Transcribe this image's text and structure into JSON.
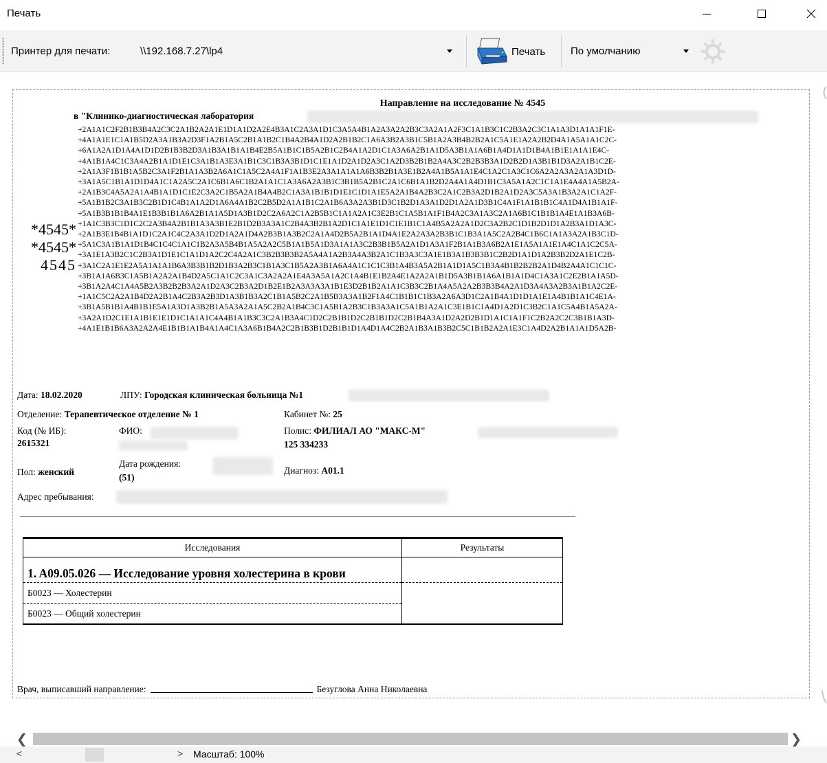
{
  "window": {
    "title": "Печать"
  },
  "toolbar": {
    "printer_label": "Принтер для печати:",
    "printer_value": "\\\\192.168.7.27\\lp4",
    "print_button": "Печать",
    "mode_value": "По умолчанию"
  },
  "document": {
    "title": "Направление на исследование № 4545",
    "laboratory": "в \"Клинико-диагностическая лаборатория",
    "barcode_lines": [
      "*4545*",
      "*4545*",
      "4545"
    ],
    "code_lines": [
      "+2A1A1C2F2B1B3B4A2C3C2A1B2A2A1E1D1A1D2A2E4B3A1C2A3A1D1C3A5A4B1A2A3A2A2B3C3A2A1A2F3C1A1B3C1C2B3A2C3C1A1A3D1A1A1F1E-",
      "+4A1A1E1C1A1B5D2A3A1B3A2D3F1A2B1A5C2B1A1B2C1B4A2B4A1D2A2B1B2C1A6A3B2A3B1C5B1A2A3B4B2B2A1C5A1E1A2A2B2D4A1A5A1A1C2C-",
      "+6A1A2A1D1A4A1D1D2B1B3B2D3A1B3A1B1A1B4E2B5A1B1C1B5A2B1C2B4A1A2D1C1A3A6A2B1A1D5A3B1A1A6B1A4D1A1D1B4A1B1E1A1A1E4C-",
      "+4A1B1A4C1C3A4A2B1A1D1E1C3A1B1A3E3A1B1C3C1B3A3B1D1C1E1A1D2A1D2A3C1A2D3B2B1B2A4A3C2B2B3B3A1D2B2D1A3B1B1D3A2A1B1C2E-",
      "+2A1A3F1B1B1A5B2C3A1F2B1A1A3B2A6A1C1A5C2A4A1F1A1B3E2A3A1A1A1A6B3B2B1A3E1B2A4A1B5A1A1E4C1A2C1A3C1C6A2A2A3A2A1A3D1D-",
      "+3A1A5C1B1A1D1D4A1C1A2A5C2A1C6B1A6C1B2A1A1C1A3A6A2A3B1C3B1B5A2B1C2A1C6B1A1B2D2A4A1A4D1B1C3A5A1A2C1C1A1E4A4A1A5B2A-",
      "+2A1B3C4A5A2A1A4B1A1D1C1E2C3A2C1B5A2A1B4A4B2C1A3A1B1B1D1E1C1D1A1E5A2A1B4A2B3C2A1C2B3A2D1B2A1D2A3C5A3A1B3A2A1C1A2F-",
      "+5A1B1B2C3A1B3C2B1D1C4B1A1A2D1A6A4A1B2C2B5D2A1A1B1C2A1B6A3A2A3B1D3C1B2D1A3A1D2D1A2A1D3B1C4A1F1A1B1B1C4A1D4A1B1A1F-",
      "+5A1B3B1B1B4A1E1B3B1B1A6A2B1A1A5D1A3B1D2C2A6A2C1A2B5B1C1A1A2A1C3E2B1C1A5B1A1F1B4A2C3A1A3C2A1A6B1C1B1B1A4E1A1B3A6B-",
      "+1A1C3B3C1D1C2C2A3B4A2B1B1A3A3B1E2B1D2B3A3A1C2B4A3B2B1A2D1C1A1E1D1C1E1B1C1A4B5A2A2A1D2C3A2B2C1D1B2D1D1A2B3A1D1A3C-",
      "+2A1B3E1B4B1A1D1C2A1C4C2A3A1D2D1A2A1D4A2B3B1A3B2C2A1A4D2B5A2B1A1D4A1E2A2A3A2B3B1C1B3A1A5C2A2B4C1B6C1A1A3A2A1B3C1D-",
      "+5A1C3A1B1A1D1B4C1C4C1A1C1B2A3A5B4B1A5A2A2C5B1A1B5A1D3A1A1A3C2B3B1B5A2A1D1A3A1F2B1A1B3A6B2A1E1A5A1A1E1A4C1A1C2C5A-",
      "+3A1E1A3B2C1C2B3A1D1E1C1A1D1A2C2C4A2A1C3B2B3B3B2A5A4A1A2B3A4A3B2A1C1B3A3C3A1E1B3A1B3B3B1C2B2D1A1D1A2B3B2D2A1E1C2B-",
      "+3A1C2A1E1E2A5A1A1A1B6A3B3B1B2D1B3A2B3C1B1A3C1B5A2A3B1A6A4A1C1C1C3B1A4B3A5A2B1A1D1A5C1B3A4B1B2B2B2A1D4B2A4A1C1C1C-",
      "+3B1A1A6B3C1A5B1A2A2A1B4D2A5C1A1C2C3A1C3A2A2A1E4A3A5A1A2C1A4B1E1B2A4E1A2A2A1B1D5A3B1B1A6A1B1A1D4C1A3A1C2E2B1A1A5D-",
      "+3B1A2A4C1A4A5B2A3B2B2B3A2A1D2A3C2B3A2D1B2E1B2A3A3A3A1B1E3D2B1B2A1A1C3B3C2B1A4A5A2A2B3B3B4A2A1D3A4A3A2B3A1B1A2C2E-",
      "+1A1C5C2A2A1B4D2A2B1A4C2B3A2B3D1A3B1B3A2C1B1A5B2C2A1B5B3A3A1B2F1A4C1B1B1C1B3A2A6A3D1C2A1B4A1D1D1A1E1A4B1B1A1C4E1A-",
      "+3B1A5B1B1A4B1B1E5A1A3D1A3B2B1A5A3A2A1A5C2B2A1B4C3C1A5B1A2B3C1B3A3A1C5A1B1A2A1C3E1B1C1A4D1A2D1C3B2C1A1C5A4B1A5A2A-",
      "+3A2A1D2C1E1A1B1E1E1D1C1A1A1C4A4B1A1B3C3C2A1B3A4C1D2C2B1B1D2C2B1B1D2C2B1B4A3A1D2A2D2B1D1A1C1A1F1C2B2A2C2C3B1B1A3D-",
      "+4A1E1B1B6A3A2A2A4E1B1B1A1B4A1A4C1A3A6B1B4A2C2B1B3B1D2B1B1D1A4D1A4C2B2A1B3A1B3B2C5C1B1B2A2A1E3C1A4D2A2B1A1A1D5A2B-"
    ],
    "date_label": "Дата:",
    "date_value": "18.02.2020",
    "lpu_label": "ЛПУ:",
    "lpu_value": "Городская клиническая больница №1",
    "department_label": "Отделение:",
    "department_value": "Терапевтическое отделение № 1",
    "cabinet_label": "Кабинет №:",
    "cabinet_value": "25",
    "code_label": "Код (№ ИБ):",
    "code_value": "2615321",
    "fio_label": "ФИО:",
    "policy_label": "Полис:",
    "policy_value": "ФИЛИАЛ АО \"МАКС-М\"",
    "policy_number": "125 334233",
    "sex_label": "Пол:",
    "sex_value": "женский",
    "birth_label": "Дата рождения:",
    "birth_age": "(51)",
    "diagnosis_label": "Диагноз:",
    "diagnosis_value": "A01.1",
    "address_label": "Адрес пребывания:",
    "table": {
      "headers": [
        "Исследования",
        "Результаты"
      ],
      "study": "1. A09.05.026 — Исследование уровня холестерина в крови",
      "items": [
        "Б0023 — Холестерин",
        "Б0023 — Общий холестерин"
      ]
    },
    "doctor_label": "Врач, выписавший направление:",
    "doctor_name": "Безуглова Анна Николаевна"
  },
  "status": {
    "zoom": "Масштаб: 100%"
  }
}
